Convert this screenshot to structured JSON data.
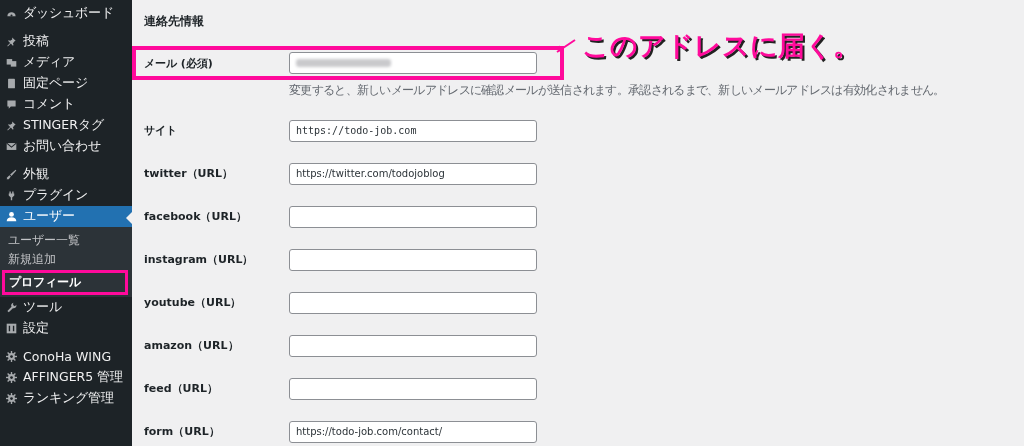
{
  "sidebar": {
    "items": [
      {
        "label": "ダッシュボード",
        "selected": false
      },
      {
        "label": "投稿",
        "selected": false
      },
      {
        "label": "メディア",
        "selected": false
      },
      {
        "label": "固定ページ",
        "selected": false
      },
      {
        "label": "コメント",
        "selected": false
      },
      {
        "label": "STINGERタグ",
        "selected": false
      },
      {
        "label": "お問い合わせ",
        "selected": false
      },
      {
        "label": "外観",
        "selected": false
      },
      {
        "label": "プラグイン",
        "selected": false
      },
      {
        "label": "ユーザー",
        "selected": true,
        "children": [
          {
            "label": "ユーザー一覧",
            "selected": false,
            "annotated": false
          },
          {
            "label": "新規追加",
            "selected": false,
            "annotated": false
          },
          {
            "label": "プロフィール",
            "selected": true,
            "annotated": true
          }
        ]
      },
      {
        "label": "ツール",
        "selected": false
      },
      {
        "label": "設定",
        "selected": false
      },
      {
        "label": "ConoHa WING",
        "selected": false
      },
      {
        "label": "AFFINGER5 管理",
        "selected": false
      },
      {
        "label": "ランキング管理",
        "selected": false
      }
    ]
  },
  "section": {
    "title": "連絡先情報",
    "fields": [
      {
        "label": "メール",
        "required_mark": "(必須)",
        "blurred": true,
        "annotated": true,
        "hint": "変更すると、新しいメールアドレスに確認メールが送信されます。承認されるまで、新しいメールアドレスは有効化されません。"
      },
      {
        "label": "サイト",
        "value": "https://todo-job.com",
        "annotated": false
      },
      {
        "label": "twitter（URL）",
        "value": "https://twitter.com/todojoblog",
        "annotated": false
      },
      {
        "label": "facebook（URL）",
        "annotated": false
      },
      {
        "label": "instagram（URL）",
        "annotated": false
      },
      {
        "label": "youtube（URL）",
        "annotated": false
      },
      {
        "label": "amazon（URL）",
        "annotated": false
      },
      {
        "label": "feed（URL）",
        "annotated": false
      },
      {
        "label": "form（URL）",
        "value": "https://todo-job.com/contact/",
        "annotated": false
      }
    ]
  },
  "callout": {
    "text": "このアドレスに届く。"
  }
}
